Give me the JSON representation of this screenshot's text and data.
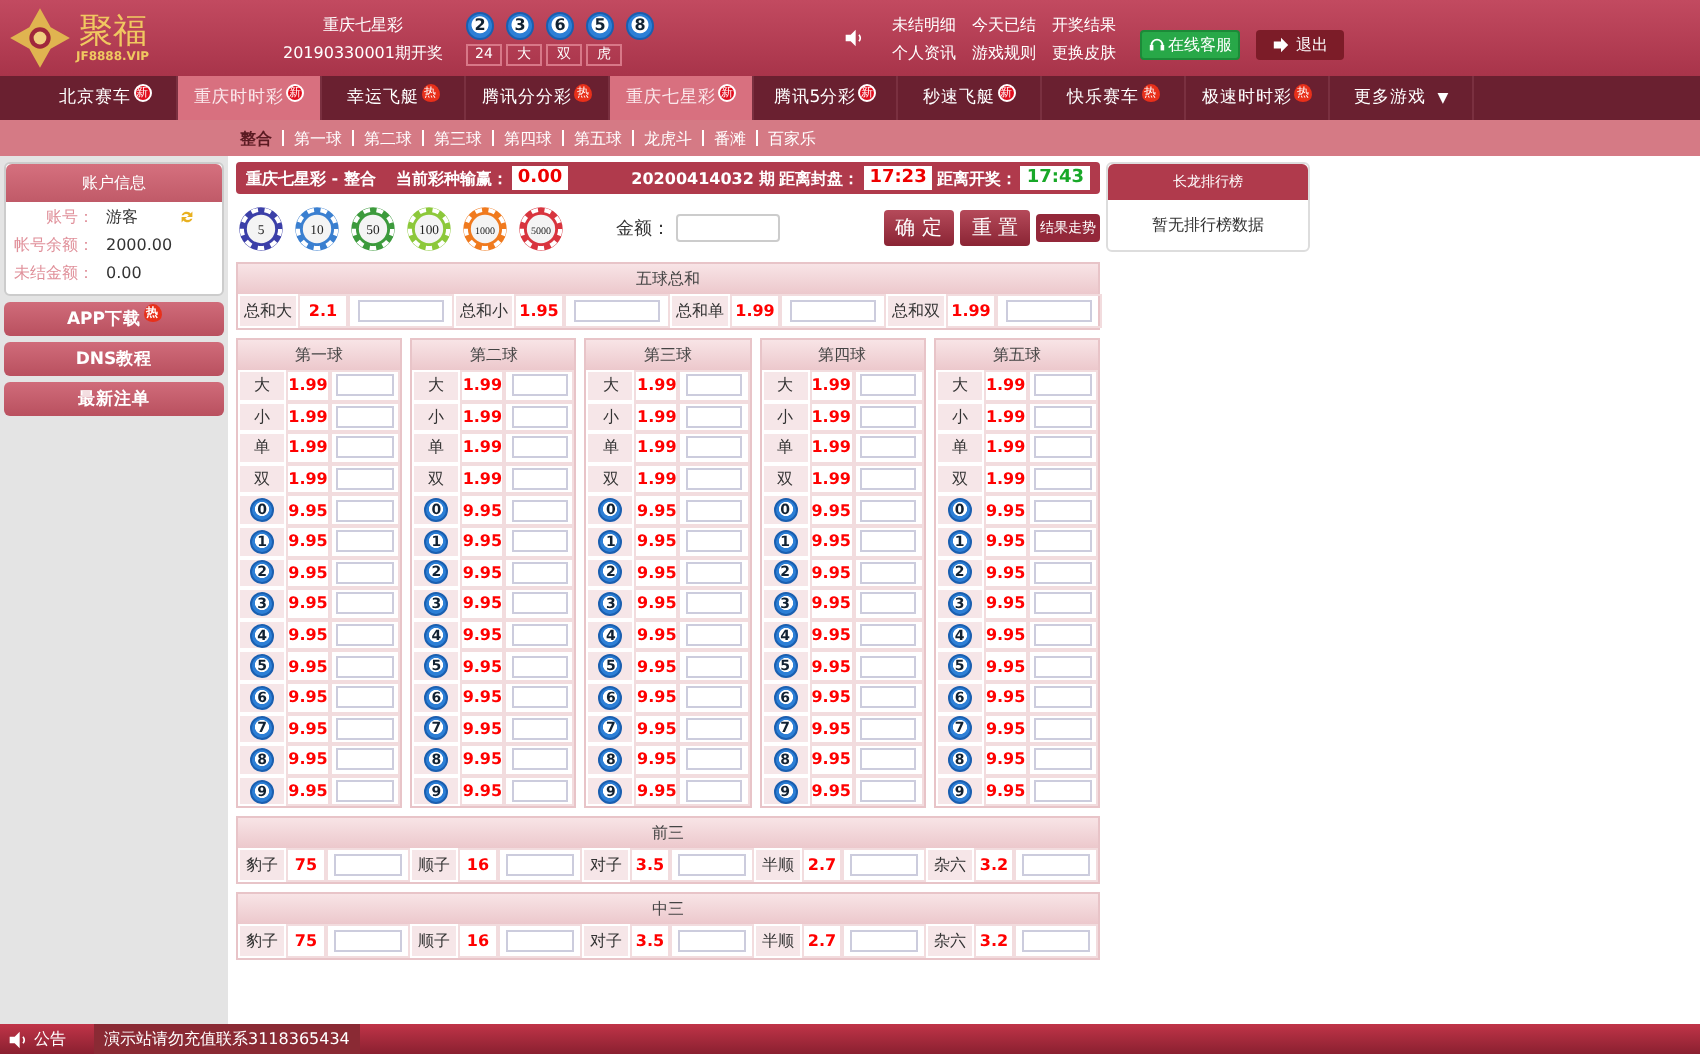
{
  "header": {
    "logo_name": "聚福",
    "logo_domain": "JF8888.VIP",
    "lottery_name": "重庆七星彩",
    "issue": "20190330001期开奖",
    "balls": [
      "2",
      "3",
      "6",
      "5",
      "8"
    ],
    "results": [
      "24",
      "大",
      "双",
      "虎"
    ],
    "links": [
      [
        "未结明细",
        "今天已结",
        "开奖结果"
      ],
      [
        "个人资讯",
        "游戏规则",
        "更换皮肤"
      ]
    ],
    "service_button": "在线客服",
    "logout_button": "退出"
  },
  "nav": {
    "tabs": [
      {
        "label": "北京赛车",
        "badge": "新",
        "kind": "new",
        "selected": false
      },
      {
        "label": "重庆时时彩",
        "badge": "新",
        "kind": "new",
        "selected": true
      },
      {
        "label": "幸运飞艇",
        "badge": "热",
        "kind": "hot",
        "selected": false
      },
      {
        "label": "腾讯分分彩",
        "badge": "热",
        "kind": "hot",
        "selected": false
      },
      {
        "label": "重庆七星彩",
        "badge": "新",
        "kind": "new",
        "selected": true
      },
      {
        "label": "腾讯5分彩",
        "badge": "新",
        "kind": "new",
        "selected": false
      },
      {
        "label": "秒速飞艇",
        "badge": "新",
        "kind": "new",
        "selected": false
      },
      {
        "label": "快乐赛车",
        "badge": "热",
        "kind": "hot",
        "selected": false
      },
      {
        "label": "极速时时彩",
        "badge": "热",
        "kind": "hot",
        "selected": false
      }
    ],
    "more": "更多游戏",
    "more_caret": "▼"
  },
  "subnav": [
    {
      "label": "整合",
      "selected": true
    },
    {
      "label": "第一球",
      "selected": false
    },
    {
      "label": "第二球",
      "selected": false
    },
    {
      "label": "第三球",
      "selected": false
    },
    {
      "label": "第四球",
      "selected": false
    },
    {
      "label": "第五球",
      "selected": false
    },
    {
      "label": "龙虎斗",
      "selected": false
    },
    {
      "label": "番滩",
      "selected": false
    },
    {
      "label": "百家乐",
      "selected": false
    }
  ],
  "sidebar": {
    "title": "账户信息",
    "rows": [
      {
        "label": "账号：",
        "value": "游客"
      },
      {
        "label": "帐号余额：",
        "value": "2000.00"
      },
      {
        "label": "未结金额：",
        "value": "0.00"
      }
    ],
    "buttons": [
      {
        "label": "APP下载",
        "badge": "热"
      },
      {
        "label": "DNS教程"
      },
      {
        "label": "最新注单"
      }
    ]
  },
  "bar": {
    "title": "重庆七星彩 - 整合",
    "profit_label": "当前彩种输赢：",
    "profit": "0.00",
    "issue": "20200414032 期",
    "close_label": "距离封盘：",
    "close_time": "17:23",
    "open_label": "距离开奖：",
    "open_time": "17:43"
  },
  "chips": [
    {
      "value": "5",
      "color": "#3b3fa8"
    },
    {
      "value": "10",
      "color": "#3a7fd0"
    },
    {
      "value": "50",
      "color": "#3c9a3c"
    },
    {
      "value": "100",
      "color": "#8cc83a"
    },
    {
      "value": "1000",
      "color": "#f07a1e"
    },
    {
      "value": "5000",
      "color": "#d8343e"
    }
  ],
  "amount_label": "金额：",
  "confirm_button": "确 定",
  "reset_button": "重 置",
  "trend_button": "结果走势",
  "ranking": {
    "title": "长龙排行榜",
    "empty": "暂无排行榜数据"
  },
  "sum": {
    "title": "五球总和",
    "cells": [
      {
        "label": "总和大",
        "odds": "2.1"
      },
      {
        "label": "总和小",
        "odds": "1.95"
      },
      {
        "label": "总和单",
        "odds": "1.99"
      },
      {
        "label": "总和双",
        "odds": "1.99"
      }
    ]
  },
  "balls": [
    {
      "title": "第一球",
      "rows": [
        {
          "kind": "text",
          "label": "大",
          "odds": "1.99"
        },
        {
          "kind": "text",
          "label": "小",
          "odds": "1.99"
        },
        {
          "kind": "text",
          "label": "单",
          "odds": "1.99"
        },
        {
          "kind": "text",
          "label": "双",
          "odds": "1.99"
        },
        {
          "kind": "ball",
          "label": "0",
          "odds": "9.95"
        },
        {
          "kind": "ball",
          "label": "1",
          "odds": "9.95"
        },
        {
          "kind": "ball",
          "label": "2",
          "odds": "9.95"
        },
        {
          "kind": "ball",
          "label": "3",
          "odds": "9.95"
        },
        {
          "kind": "ball",
          "label": "4",
          "odds": "9.95"
        },
        {
          "kind": "ball",
          "label": "5",
          "odds": "9.95"
        },
        {
          "kind": "ball",
          "label": "6",
          "odds": "9.95"
        },
        {
          "kind": "ball",
          "label": "7",
          "odds": "9.95"
        },
        {
          "kind": "ball",
          "label": "8",
          "odds": "9.95"
        },
        {
          "kind": "ball",
          "label": "9",
          "odds": "9.95"
        }
      ]
    },
    {
      "title": "第二球",
      "rows": [
        {
          "kind": "text",
          "label": "大",
          "odds": "1.99"
        },
        {
          "kind": "text",
          "label": "小",
          "odds": "1.99"
        },
        {
          "kind": "text",
          "label": "单",
          "odds": "1.99"
        },
        {
          "kind": "text",
          "label": "双",
          "odds": "1.99"
        },
        {
          "kind": "ball",
          "label": "0",
          "odds": "9.95"
        },
        {
          "kind": "ball",
          "label": "1",
          "odds": "9.95"
        },
        {
          "kind": "ball",
          "label": "2",
          "odds": "9.95"
        },
        {
          "kind": "ball",
          "label": "3",
          "odds": "9.95"
        },
        {
          "kind": "ball",
          "label": "4",
          "odds": "9.95"
        },
        {
          "kind": "ball",
          "label": "5",
          "odds": "9.95"
        },
        {
          "kind": "ball",
          "label": "6",
          "odds": "9.95"
        },
        {
          "kind": "ball",
          "label": "7",
          "odds": "9.95"
        },
        {
          "kind": "ball",
          "label": "8",
          "odds": "9.95"
        },
        {
          "kind": "ball",
          "label": "9",
          "odds": "9.95"
        }
      ]
    },
    {
      "title": "第三球",
      "rows": [
        {
          "kind": "text",
          "label": "大",
          "odds": "1.99"
        },
        {
          "kind": "text",
          "label": "小",
          "odds": "1.99"
        },
        {
          "kind": "text",
          "label": "单",
          "odds": "1.99"
        },
        {
          "kind": "text",
          "label": "双",
          "odds": "1.99"
        },
        {
          "kind": "ball",
          "label": "0",
          "odds": "9.95"
        },
        {
          "kind": "ball",
          "label": "1",
          "odds": "9.95"
        },
        {
          "kind": "ball",
          "label": "2",
          "odds": "9.95"
        },
        {
          "kind": "ball",
          "label": "3",
          "odds": "9.95"
        },
        {
          "kind": "ball",
          "label": "4",
          "odds": "9.95"
        },
        {
          "kind": "ball",
          "label": "5",
          "odds": "9.95"
        },
        {
          "kind": "ball",
          "label": "6",
          "odds": "9.95"
        },
        {
          "kind": "ball",
          "label": "7",
          "odds": "9.95"
        },
        {
          "kind": "ball",
          "label": "8",
          "odds": "9.95"
        },
        {
          "kind": "ball",
          "label": "9",
          "odds": "9.95"
        }
      ]
    },
    {
      "title": "第四球",
      "rows": [
        {
          "kind": "text",
          "label": "大",
          "odds": "1.99"
        },
        {
          "kind": "text",
          "label": "小",
          "odds": "1.99"
        },
        {
          "kind": "text",
          "label": "单",
          "odds": "1.99"
        },
        {
          "kind": "text",
          "label": "双",
          "odds": "1.99"
        },
        {
          "kind": "ball",
          "label": "0",
          "odds": "9.95"
        },
        {
          "kind": "ball",
          "label": "1",
          "odds": "9.95"
        },
        {
          "kind": "ball",
          "label": "2",
          "odds": "9.95"
        },
        {
          "kind": "ball",
          "label": "3",
          "odds": "9.95"
        },
        {
          "kind": "ball",
          "label": "4",
          "odds": "9.95"
        },
        {
          "kind": "ball",
          "label": "5",
          "odds": "9.95"
        },
        {
          "kind": "ball",
          "label": "6",
          "odds": "9.95"
        },
        {
          "kind": "ball",
          "label": "7",
          "odds": "9.95"
        },
        {
          "kind": "ball",
          "label": "8",
          "odds": "9.95"
        },
        {
          "kind": "ball",
          "label": "9",
          "odds": "9.95"
        }
      ]
    },
    {
      "title": "第五球",
      "rows": [
        {
          "kind": "text",
          "label": "大",
          "odds": "1.99"
        },
        {
          "kind": "text",
          "label": "小",
          "odds": "1.99"
        },
        {
          "kind": "text",
          "label": "单",
          "odds": "1.99"
        },
        {
          "kind": "text",
          "label": "双",
          "odds": "1.99"
        },
        {
          "kind": "ball",
          "label": "0",
          "odds": "9.95"
        },
        {
          "kind": "ball",
          "label": "1",
          "odds": "9.95"
        },
        {
          "kind": "ball",
          "label": "2",
          "odds": "9.95"
        },
        {
          "kind": "ball",
          "label": "3",
          "odds": "9.95"
        },
        {
          "kind": "ball",
          "label": "4",
          "odds": "9.95"
        },
        {
          "kind": "ball",
          "label": "5",
          "odds": "9.95"
        },
        {
          "kind": "ball",
          "label": "6",
          "odds": "9.95"
        },
        {
          "kind": "ball",
          "label": "7",
          "odds": "9.95"
        },
        {
          "kind": "ball",
          "label": "8",
          "odds": "9.95"
        },
        {
          "kind": "ball",
          "label": "9",
          "odds": "9.95"
        }
      ]
    }
  ],
  "groups": [
    {
      "title": "前三",
      "cells": [
        {
          "label": "豹子",
          "odds": "75"
        },
        {
          "label": "顺子",
          "odds": "16"
        },
        {
          "label": "对子",
          "odds": "3.5"
        },
        {
          "label": "半顺",
          "odds": "2.7"
        },
        {
          "label": "杂六",
          "odds": "3.2"
        }
      ]
    },
    {
      "title": "中三",
      "cells": [
        {
          "label": "豹子",
          "odds": "75"
        },
        {
          "label": "顺子",
          "odds": "16"
        },
        {
          "label": "对子",
          "odds": "3.5"
        },
        {
          "label": "半顺",
          "odds": "2.7"
        },
        {
          "label": "杂六",
          "odds": "3.2"
        }
      ]
    }
  ],
  "footer": {
    "label": "公告",
    "message": "演示站请勿充值联系3118365434"
  }
}
